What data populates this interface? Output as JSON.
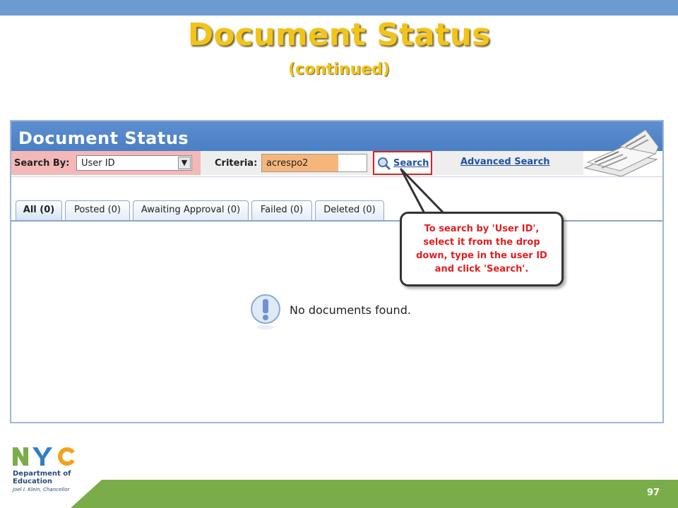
{
  "slide": {
    "title": "Document Status",
    "subtitle": "(continued)",
    "page_number": "97"
  },
  "app": {
    "title": "Document Status",
    "search": {
      "search_by_label": "Search By:",
      "search_by_value": "User ID",
      "criteria_label": "Criteria:",
      "criteria_value": "acrespo2",
      "search_button": "Search",
      "advanced_search": "Advanced Search"
    },
    "tabs": [
      {
        "label": "All (0)",
        "active": true
      },
      {
        "label": "Posted (0)",
        "active": false
      },
      {
        "label": "Awaiting Approval (0)",
        "active": false
      },
      {
        "label": "Failed (0)",
        "active": false
      },
      {
        "label": "Deleted (0)",
        "active": false
      }
    ],
    "empty_message": "No documents found."
  },
  "callout": {
    "text": "To search by 'User ID', select it from the drop down, type in the user ID and click 'Search'."
  },
  "logo": {
    "line1": "Department of",
    "line2": "Education",
    "chancellor": "Joel I. Klein, Chancellor"
  },
  "colors": {
    "title": "#f2c41a",
    "header": "#4a7fc4",
    "highlight_red": "#e02020",
    "search_by_highlight": "#f4b8b8",
    "criteria_highlight": "#f6b67a",
    "footer": "#7aad4a"
  }
}
